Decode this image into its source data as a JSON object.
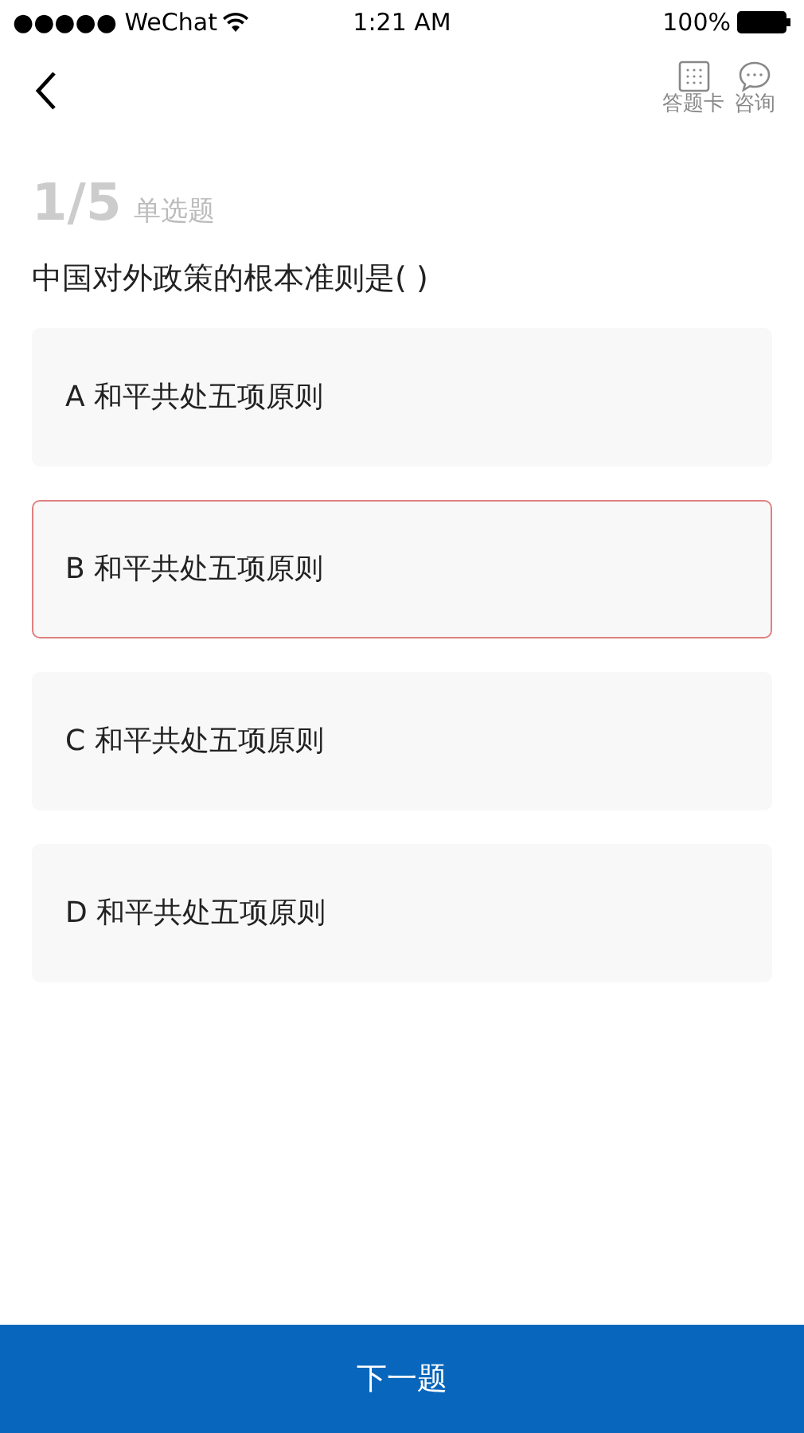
{
  "status_bar": {
    "carrier": "●●●●● WeChat",
    "time": "1:21 AM",
    "battery": "100%"
  },
  "header": {
    "actions": [
      {
        "kind": "card",
        "label": "答题卡"
      },
      {
        "kind": "chat",
        "label": "咨询"
      }
    ]
  },
  "progress": {
    "current": "1/5",
    "type": "单选题"
  },
  "question": "中国对外政策的根本准则是(  )",
  "options": [
    {
      "text": "A 和平共处五项原则",
      "selected": false
    },
    {
      "text": "B 和平共处五项原则",
      "selected": true
    },
    {
      "text": "C 和平共处五项原则",
      "selected": false
    },
    {
      "text": "D 和平共处五项原则",
      "selected": false
    }
  ],
  "next_button": "下一题"
}
